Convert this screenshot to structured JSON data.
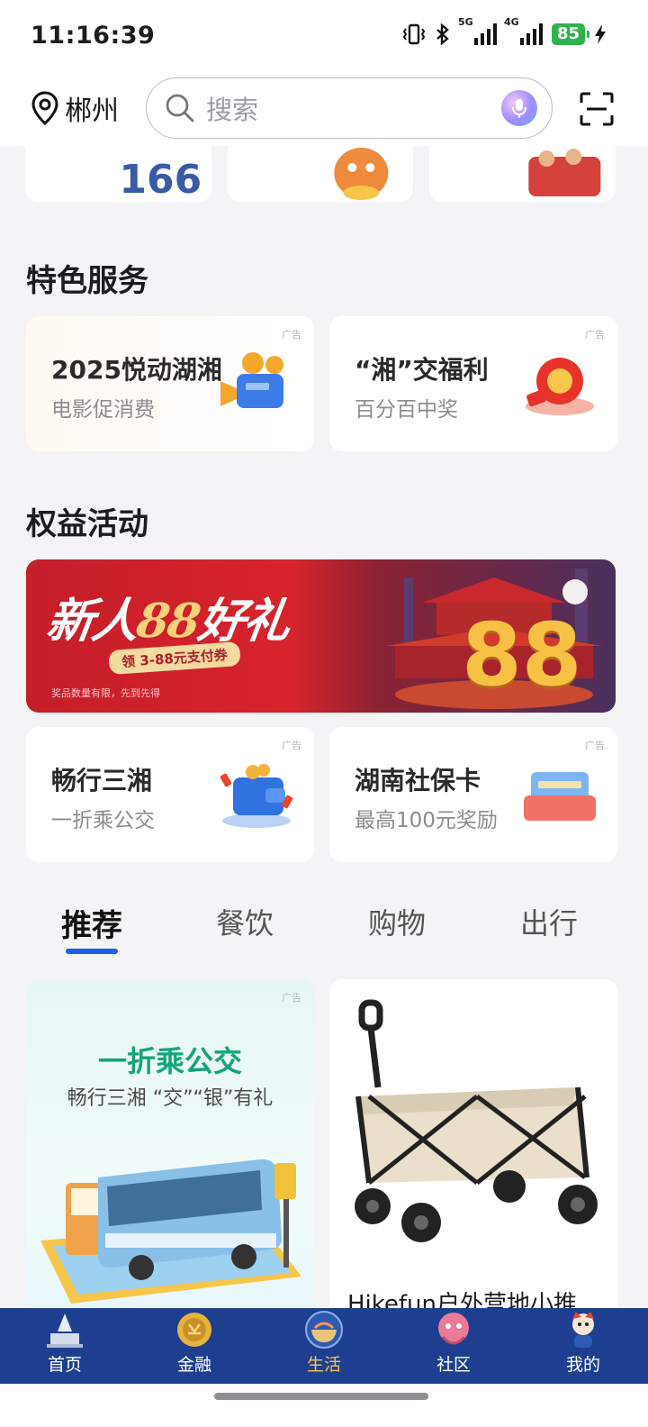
{
  "status_bar": {
    "time": "11:16:39",
    "network_5g": "5G",
    "network_4g": "4G",
    "battery": "85"
  },
  "header": {
    "location": "郴州",
    "search_placeholder": "搜索"
  },
  "sections": {
    "featured_title": "特色服务",
    "benefits_title": "权益活动"
  },
  "featured_services": [
    {
      "title": "2025悦动湖湘",
      "subtitle": "电影促消费",
      "ad_label": "广告",
      "icon": "movie-camera-icon"
    },
    {
      "title": "“湘”交福利",
      "subtitle": "百分百中奖",
      "ad_label": "广告",
      "icon": "lucky-draw-icon"
    }
  ],
  "promo_banner": {
    "title_prefix": "新人",
    "title_number": "88",
    "title_suffix": "好礼",
    "subtitle": "领 3-88元支付券",
    "note": "奖品数量有限，先到先得",
    "big_number": "88"
  },
  "benefit_cards": [
    {
      "title": "畅行三湘",
      "subtitle": "一折乘公交",
      "ad_label": "广告",
      "icon": "wallet-icon"
    },
    {
      "title": "湖南社保卡",
      "subtitle": "最高100元奖励",
      "ad_label": "广告",
      "icon": "social-security-card-icon"
    }
  ],
  "tabs": [
    "推荐",
    "餐饮",
    "购物",
    "出行"
  ],
  "active_tab": "推荐",
  "feed": {
    "left": {
      "ad_label": "广告",
      "headline": "一折乘公交",
      "subline": "畅行三湘 “交”“银”有礼"
    },
    "right": {
      "product_name": "Hikefun户外营地小推"
    }
  },
  "bottom_nav": [
    {
      "label": "首页",
      "icon": "home-building-icon"
    },
    {
      "label": "金融",
      "icon": "coin-icon"
    },
    {
      "label": "生活",
      "icon": "life-bowl-icon"
    },
    {
      "label": "社区",
      "icon": "community-icon"
    },
    {
      "label": "我的",
      "icon": "mascot-icon"
    }
  ],
  "active_nav": "生活",
  "colors": {
    "accent_blue": "#1d5ee8",
    "nav_bg": "#1e3f8f",
    "nav_active": "#f6c65a",
    "feed_green": "#13a47b",
    "battery_green": "#2fb24d"
  }
}
